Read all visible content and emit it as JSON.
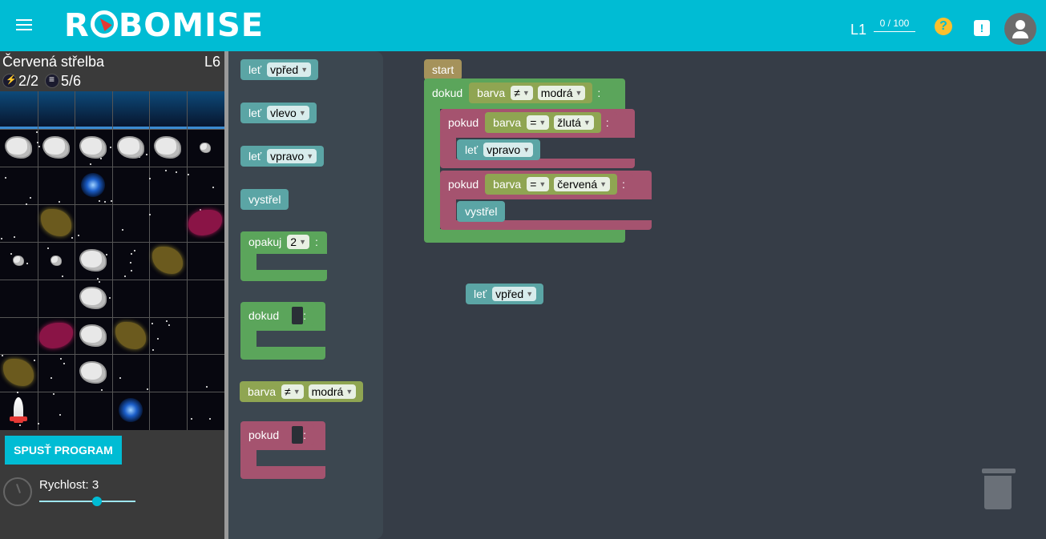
{
  "header": {
    "logo_text": "ROBOMISE",
    "level_code": "L1",
    "progress_text": "0 / 100",
    "help_icon": "question-circle-icon",
    "feedback_icon": "feedback-icon",
    "avatar_icon": "person-icon",
    "accent_color": "#00bcd4"
  },
  "task": {
    "title": "Červená střelba",
    "level": "L6",
    "energy": "2/2",
    "actions": "5/6"
  },
  "controls": {
    "run_label": "SPUSŤ PROGRAM",
    "speed_label": "Rychlost: 3",
    "speed_value": 3,
    "speed_max": 5
  },
  "board": {
    "rows": [
      [
        "ast",
        "ast",
        "ast",
        "ast",
        "ast",
        "ast-sm"
      ],
      [
        "",
        "",
        "wormhole",
        "",
        "",
        ""
      ],
      [
        "",
        "nebula-y",
        "",
        "",
        "",
        "nebula-r"
      ],
      [
        "ast-sm",
        "ast-sm",
        "ast",
        "",
        "nebula-y",
        ""
      ],
      [
        "",
        "",
        "ast",
        "",
        "",
        ""
      ],
      [
        "",
        "nebula-r",
        "ast",
        "nebula-y",
        "",
        ""
      ],
      [
        "nebula-y",
        "",
        "ast",
        "",
        "",
        ""
      ],
      [
        "ship",
        "",
        "",
        "wormhole",
        "",
        ""
      ]
    ]
  },
  "toolbox": {
    "let_label": "leť",
    "opt_vpred": "vpřed",
    "opt_vlevo": "vlevo",
    "opt_vpravo": "vpravo",
    "shoot_label": "vystřel",
    "repeat_label": "opakuj",
    "repeat_value": "2",
    "while_label": "dokud",
    "color_label": "barva",
    "neq_op": "≠",
    "color_blue": "modrá",
    "if_label": "pokud",
    "colon": ":"
  },
  "workspace": {
    "start_label": "start",
    "while_label": "dokud",
    "color_label": "barva",
    "neq_op": "≠",
    "eq_op": "=",
    "color_blue": "modrá",
    "color_yellow": "žlutá",
    "color_red": "červená",
    "if_label": "pokud",
    "let_label": "leť",
    "opt_vpravo": "vpravo",
    "opt_vpred": "vpřed",
    "shoot_label": "vystřel",
    "colon": ":"
  }
}
